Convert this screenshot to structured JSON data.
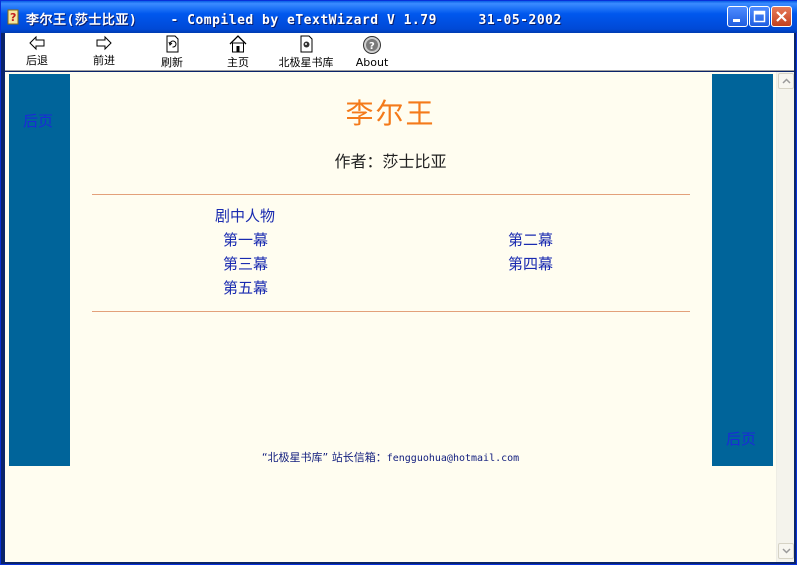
{
  "window": {
    "title": "李尔王(莎士比亚)    - Compiled by eTextWizard V 1.79     31-05-2002"
  },
  "toolbar": {
    "items": [
      {
        "label": "后退",
        "icon": "back-arrow-icon"
      },
      {
        "label": "前进",
        "icon": "forward-arrow-icon"
      },
      {
        "label": "刷新",
        "icon": "refresh-icon"
      },
      {
        "label": "主页",
        "icon": "home-icon"
      },
      {
        "label": "北极星书库",
        "icon": "library-icon"
      },
      {
        "label": "About",
        "icon": "about-icon"
      }
    ]
  },
  "page": {
    "left_nav": "后页",
    "right_nav": "后页",
    "title": "李尔王",
    "author": "作者：莎士比亚",
    "toc": [
      "剧中人物",
      "第一幕",
      "第二幕",
      "第三幕",
      "第四幕",
      "第五幕"
    ],
    "footer_site": "“北极星书库” 站长信箱：",
    "footer_email": "fengguohua@hotmail.com"
  },
  "colors": {
    "side_panel": "#00649A",
    "title": "#F47A1A",
    "link": "#1A2BB0",
    "background": "#FFFDF0"
  }
}
